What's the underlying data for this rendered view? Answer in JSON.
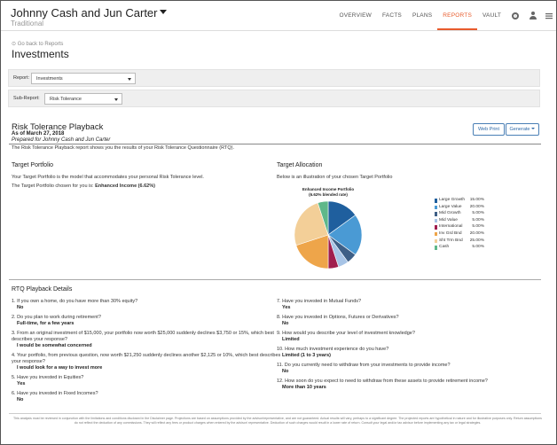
{
  "header": {
    "client_name": "Johnny Cash and Jun Carter",
    "client_type": "Traditional",
    "nav": [
      "OVERVIEW",
      "FACTS",
      "PLANS",
      "REPORTS",
      "VAULT"
    ],
    "active_nav": "REPORTS"
  },
  "page": {
    "back_link": "Go back to Reports",
    "title": "Investments"
  },
  "filters": {
    "report_label": "Report:",
    "report_value": "Investments",
    "subreport_label": "Sub-Report:",
    "subreport_value": "Risk Tolerance"
  },
  "report": {
    "title": "Risk Tolerance Playback",
    "as_of": "As of March 27, 2018",
    "prepared_for": "Prepared for Johnny Cash and Jun Carter",
    "description": "The Risk Tolerance Playback report shows you the results of your Risk Tolerance Questionnaire (RTQ).",
    "web_print_label": "Web Print",
    "generate_label": "Generate"
  },
  "target_portfolio": {
    "heading": "Target Portfolio",
    "line1": "Your Target Portfolio is the model that accommodates your personal Risk Tolerance level.",
    "line2_prefix": "The Target Portfolio chosen for you is:",
    "line2_value": "Enhanced Income (6.62%)"
  },
  "target_allocation": {
    "heading": "Target Allocation",
    "subtext": "Below is an illustration of your chosen Target Portfolio",
    "chart_title": "Enhanced Income Portfolio",
    "chart_subtitle": "(6.62% blended rate)"
  },
  "chart_data": {
    "type": "pie",
    "title": "Enhanced Income Portfolio",
    "subtitle": "(6.62% blended rate)",
    "legend_placement": "right",
    "slices": [
      {
        "name": "Large Growth",
        "value": 15.0,
        "label": "15.00%",
        "color": "#1f5f9e"
      },
      {
        "name": "Large Value",
        "value": 20.0,
        "label": "20.00%",
        "color": "#4a9ad4"
      },
      {
        "name": "Mid Growth",
        "value": 5.0,
        "label": "5.00%",
        "color": "#3e5f86"
      },
      {
        "name": "Mid Value",
        "value": 5.0,
        "label": "5.00%",
        "color": "#a7c4e6"
      },
      {
        "name": "International",
        "value": 5.0,
        "label": "5.00%",
        "color": "#a01e4e"
      },
      {
        "name": "Inv Grd Bnd",
        "value": 20.0,
        "label": "20.00%",
        "color": "#eea54a"
      },
      {
        "name": "Sht Trm Bnd",
        "value": 25.0,
        "label": "25.00%",
        "color": "#f3cf98"
      },
      {
        "name": "Cash",
        "value": 5.0,
        "label": "5.00%",
        "color": "#5fb88a"
      }
    ]
  },
  "rtq": {
    "heading": "RTQ Playback Details",
    "left": [
      {
        "q": [
          "1. If you own a home, do you have more than 30% equity?"
        ],
        "a": "No"
      },
      {
        "q": [
          "2. Do you plan to work during retirement?"
        ],
        "a": "Full-time, for a few years"
      },
      {
        "q": [
          "3. From an original investment of $15,000, your portfolio now worth $25,000 suddenly declines $3,750 or 15%, which best",
          "describes your response?"
        ],
        "a": "I would be somewhat concerned"
      },
      {
        "q": [
          "4. Your portfolio, from previous question, now worth $21,250 suddenly declines another $2,125 or 10%, which best describes",
          "your response?"
        ],
        "a": "I would look for a way to invest more"
      },
      {
        "q": [
          "5. Have you invested in Equities?"
        ],
        "a": "Yes"
      },
      {
        "q": [
          "6. Have you invested in Fixed Incomes?"
        ],
        "a": "No"
      }
    ],
    "right": [
      {
        "q": [
          "7. Have you invested in Mutual Funds?"
        ],
        "a": "Yes"
      },
      {
        "q": [
          "8. Have you invested in Options, Futures or Derivatives?"
        ],
        "a": "No"
      },
      {
        "q": [
          "9. How would you describe your level of investment knowledge?"
        ],
        "a": "Limited"
      },
      {
        "q": [
          "10. How much investment experience do you have?"
        ],
        "a": "Limited (1 to 3 years)"
      },
      {
        "q": [
          "11. Do you currently need to withdraw from your investments to provide income?"
        ],
        "a": "No"
      },
      {
        "q": [
          "12. How soon do you expect to need to withdraw from these assets to provide retirement income?"
        ],
        "a": "More than 10 years"
      }
    ]
  },
  "disclaimer": "This analysis must be reviewed in conjunction with the limitations and conditions disclosed in the Disclaimer page. Projections are based on assumptions provided by the advisor/representative, and are not guaranteed. Actual results will vary, perhaps to a significant degree. The projected reports are hypothetical in nature and for illustrative purposes only. Return assumptions do not reflect the deduction of any commissions. They will reflect any fees or product charges when entered by the advisor/ representative. Deduction of such charges would result in a lower rate of return. Consult your legal and/or tax advisor before implementing any tax or legal strategies."
}
